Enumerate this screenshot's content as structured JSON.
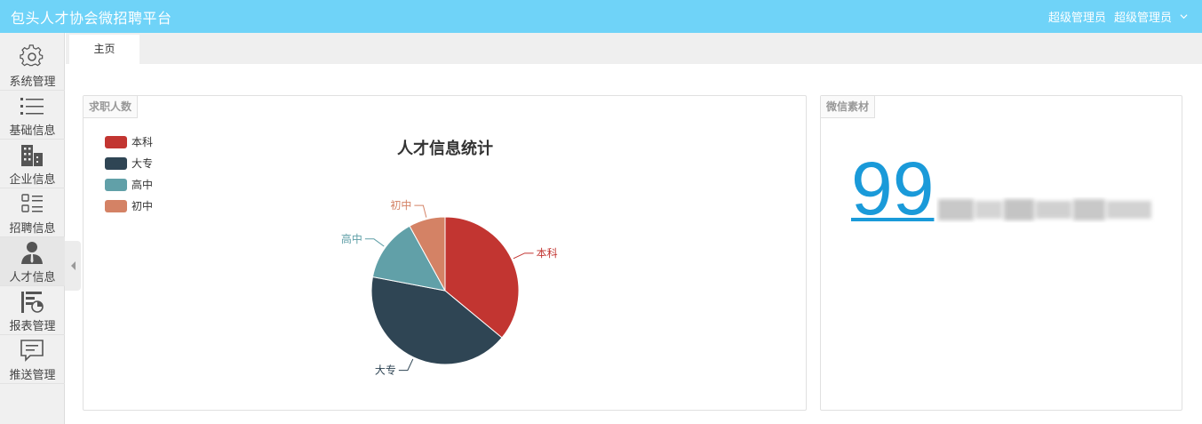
{
  "header": {
    "title": "包头人才协会微招聘平台",
    "user_role": "超级管理员",
    "user_name": "超级管理员",
    "background": "#6fd3f8"
  },
  "sidebar": {
    "items": [
      {
        "label": "系统管理",
        "icon": "gear-icon"
      },
      {
        "label": "基础信息",
        "icon": "list-icon"
      },
      {
        "label": "企业信息",
        "icon": "building-icon"
      },
      {
        "label": "招聘信息",
        "icon": "recruit-list-icon"
      },
      {
        "label": "人才信息",
        "icon": "person-icon"
      },
      {
        "label": "报表管理",
        "icon": "report-icon"
      },
      {
        "label": "推送管理",
        "icon": "message-icon"
      }
    ],
    "active_index": 4
  },
  "tabs": [
    {
      "label": "主页"
    }
  ],
  "panels": {
    "left_title": "求职人数",
    "right_title": "微信素材"
  },
  "wechat": {
    "count": "99"
  },
  "chart_data": {
    "type": "pie",
    "title": "人才信息统计",
    "legend_position": "top-left",
    "categories": [
      "本科",
      "大专",
      "高中",
      "初中"
    ],
    "values": [
      36,
      42,
      14,
      8
    ],
    "colors": [
      "#c23531",
      "#2f4554",
      "#61a0a8",
      "#d48265"
    ]
  }
}
